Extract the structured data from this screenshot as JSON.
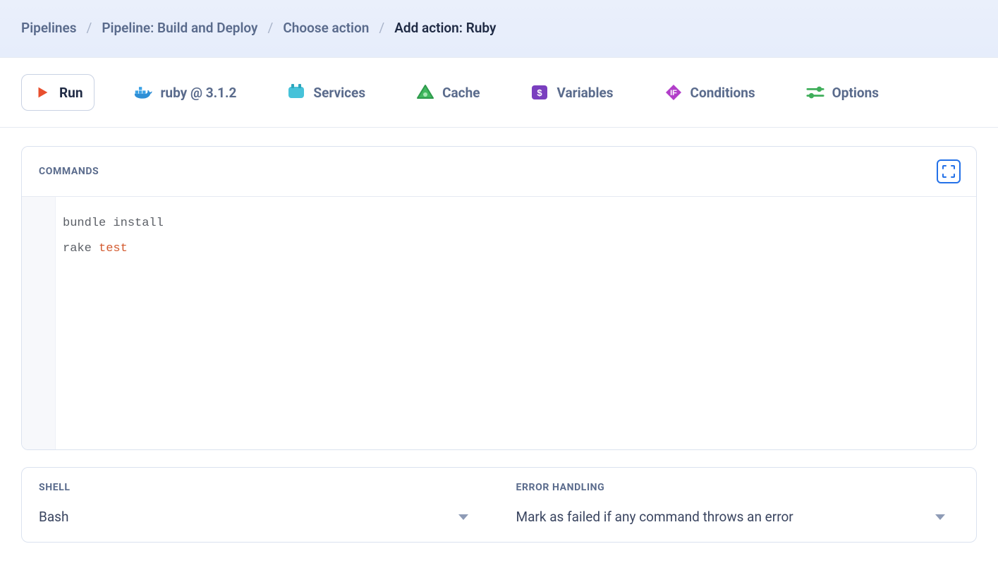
{
  "breadcrumb": {
    "items": [
      "Pipelines",
      "Pipeline: Build and Deploy",
      "Choose action"
    ],
    "current": "Add action: Ruby"
  },
  "tabs": {
    "run": "Run",
    "ruby": "ruby @ 3.1.2",
    "services": "Services",
    "cache": "Cache",
    "variables": "Variables",
    "conditions": "Conditions",
    "options": "Options"
  },
  "commands": {
    "label": "COMMANDS",
    "lines": [
      {
        "plain": "bundle install"
      },
      {
        "plain": "rake ",
        "kw": "test"
      }
    ]
  },
  "shell": {
    "label": "SHELL",
    "value": "Bash"
  },
  "error_handling": {
    "label": "ERROR HANDLING",
    "value": "Mark as failed if any command throws an error"
  }
}
